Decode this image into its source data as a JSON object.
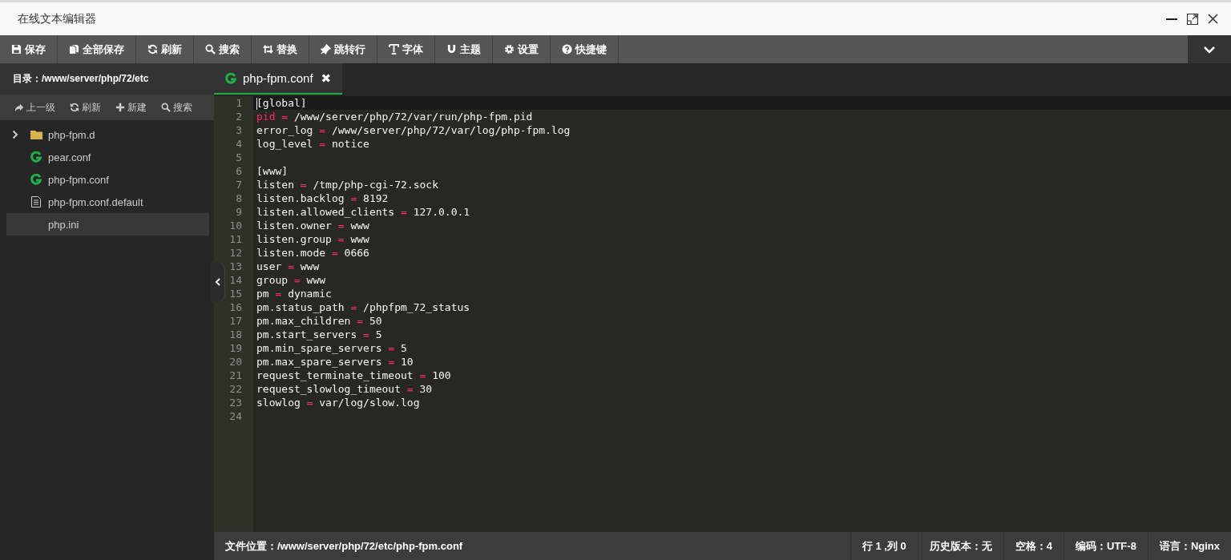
{
  "window": {
    "title": "在线文本编辑器"
  },
  "toolbar": [
    {
      "label": "保存"
    },
    {
      "label": "全部保存"
    },
    {
      "label": "刷新"
    },
    {
      "label": "搜索"
    },
    {
      "label": "替换"
    },
    {
      "label": "跳转行"
    },
    {
      "label": "字体"
    },
    {
      "label": "主题"
    },
    {
      "label": "设置"
    },
    {
      "label": "快捷键"
    }
  ],
  "sidebar": {
    "directory": "目录：/www/server/php/72/etc",
    "actions": [
      {
        "label": "上一级"
      },
      {
        "label": "刷新"
      },
      {
        "label": "新建"
      },
      {
        "label": "搜索"
      }
    ],
    "items": [
      {
        "kind": "folder",
        "name": "php-fpm.d",
        "expanded": false,
        "selected": false
      },
      {
        "kind": "config",
        "name": "pear.conf",
        "selected": false
      },
      {
        "kind": "config",
        "name": "php-fpm.conf",
        "selected": false
      },
      {
        "kind": "text",
        "name": "php-fpm.conf.default",
        "selected": false
      },
      {
        "kind": "plain",
        "name": "php.ini",
        "selected": true
      }
    ]
  },
  "tabs": [
    {
      "label": "php-fpm.conf",
      "close": "✖",
      "selected": true
    }
  ],
  "editor": {
    "lines": [
      {
        "number": "1",
        "kind": "section",
        "text": "[global]",
        "current": true
      },
      {
        "number": "2",
        "kind": "pair",
        "key": "pid",
        "operator": "=",
        "value": "/www/server/php/72/var/run/php-fpm.pid",
        "key_highlighted": true,
        "current": false
      },
      {
        "number": "3",
        "kind": "pair",
        "key": "error_log",
        "operator": "=",
        "value": "/www/server/php/72/var/log/php-fpm.log",
        "key_highlighted": false,
        "current": false
      },
      {
        "number": "4",
        "kind": "pair",
        "key": "log_level",
        "operator": "=",
        "value": "notice",
        "key_highlighted": false,
        "current": false
      },
      {
        "number": "5",
        "kind": "blank",
        "current": false
      },
      {
        "number": "6",
        "kind": "section",
        "text": "[www]",
        "current": false
      },
      {
        "number": "7",
        "kind": "pair",
        "key": "listen",
        "operator": "=",
        "value": "/tmp/php-cgi-72.sock",
        "key_highlighted": false,
        "current": false
      },
      {
        "number": "8",
        "kind": "pair",
        "key": "listen.backlog",
        "operator": "=",
        "value": "8192",
        "key_highlighted": false,
        "current": false
      },
      {
        "number": "9",
        "kind": "pair",
        "key": "listen.allowed_clients",
        "operator": "=",
        "value": "127.0.0.1",
        "key_highlighted": false,
        "current": false
      },
      {
        "number": "10",
        "kind": "pair",
        "key": "listen.owner",
        "operator": "=",
        "value": "www",
        "key_highlighted": false,
        "current": false
      },
      {
        "number": "11",
        "kind": "pair",
        "key": "listen.group",
        "operator": "=",
        "value": "www",
        "key_highlighted": false,
        "current": false
      },
      {
        "number": "12",
        "kind": "pair",
        "key": "listen.mode",
        "operator": "=",
        "value": "0666",
        "key_highlighted": false,
        "current": false
      },
      {
        "number": "13",
        "kind": "pair",
        "key": "user",
        "operator": "=",
        "value": "www",
        "key_highlighted": false,
        "current": false
      },
      {
        "number": "14",
        "kind": "pair",
        "key": "group",
        "operator": "=",
        "value": "www",
        "key_highlighted": false,
        "current": false
      },
      {
        "number": "15",
        "kind": "pair",
        "key": "pm",
        "operator": "=",
        "value": "dynamic",
        "key_highlighted": false,
        "current": false
      },
      {
        "number": "16",
        "kind": "pair",
        "key": "pm.status_path",
        "operator": "=",
        "value": "/phpfpm_72_status",
        "key_highlighted": false,
        "current": false
      },
      {
        "number": "17",
        "kind": "pair",
        "key": "pm.max_children",
        "operator": "=",
        "value": "50",
        "key_highlighted": false,
        "current": false
      },
      {
        "number": "18",
        "kind": "pair",
        "key": "pm.start_servers",
        "operator": "=",
        "value": "5",
        "key_highlighted": false,
        "current": false
      },
      {
        "number": "19",
        "kind": "pair",
        "key": "pm.min_spare_servers",
        "operator": "=",
        "value": "5",
        "key_highlighted": false,
        "current": false
      },
      {
        "number": "20",
        "kind": "pair",
        "key": "pm.max_spare_servers",
        "operator": "=",
        "value": "10",
        "key_highlighted": false,
        "current": false
      },
      {
        "number": "21",
        "kind": "pair",
        "key": "request_terminate_timeout",
        "operator": "=",
        "value": "100",
        "key_highlighted": false,
        "current": false
      },
      {
        "number": "22",
        "kind": "pair",
        "key": "request_slowlog_timeout",
        "operator": "=",
        "value": "30",
        "key_highlighted": false,
        "current": false
      },
      {
        "number": "23",
        "kind": "pair",
        "key": "slowlog",
        "operator": "=",
        "value": "var/log/slow.log",
        "key_highlighted": false,
        "current": false
      },
      {
        "number": "24",
        "kind": "blank",
        "current": false
      }
    ]
  },
  "status_bar": {
    "path": "文件位置：/www/server/php/72/etc/php-fpm.conf",
    "items": [
      "行 1 ,列 0",
      "历史版本：无",
      "空格：4",
      "编码：UTF-8",
      "语言：Nginx"
    ]
  }
}
